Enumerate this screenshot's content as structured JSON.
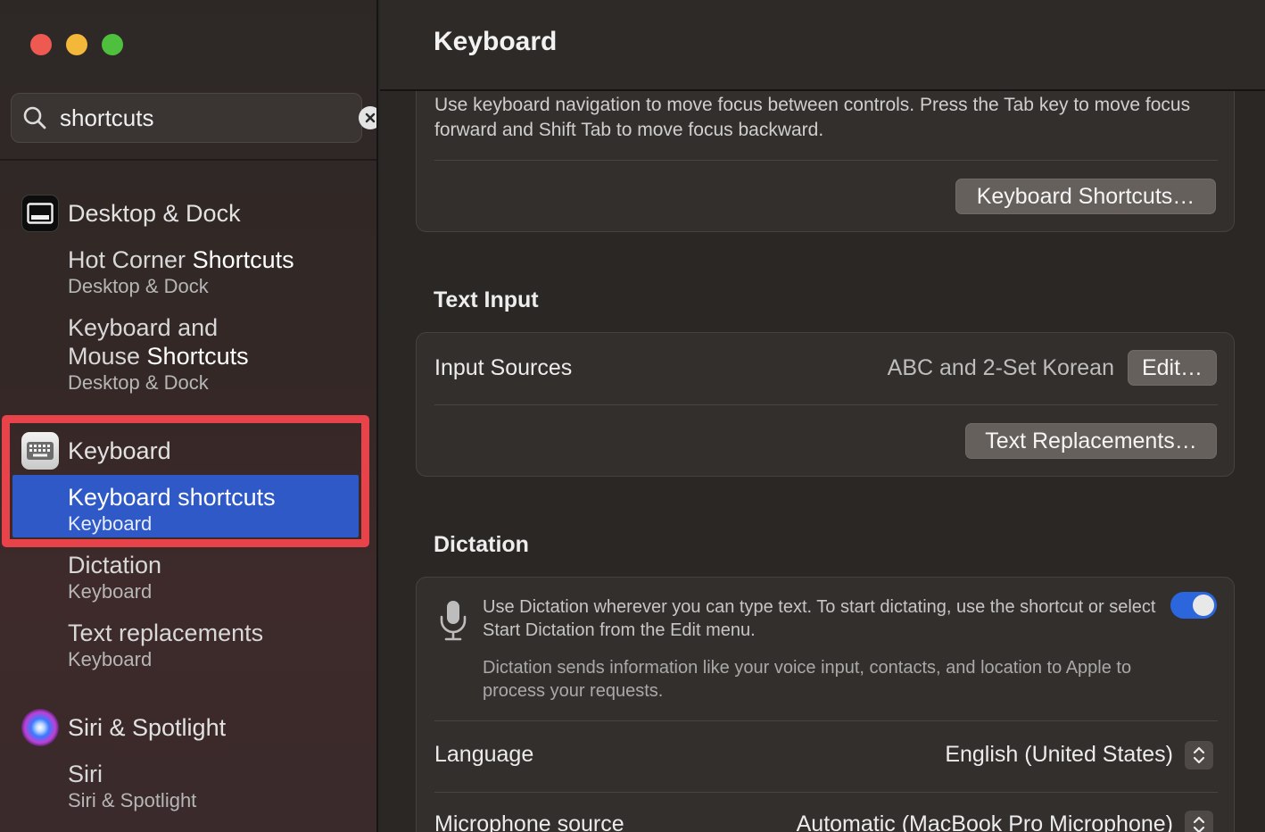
{
  "search": {
    "value": "shortcuts"
  },
  "sidebar": {
    "groups": [
      {
        "label": "Desktop & Dock",
        "results": [
          {
            "title_pre": "Hot Corner ",
            "title_match": "Shortcuts",
            "subtitle": "Desktop & Dock"
          },
          {
            "title_pre": "Keyboard and\nMouse ",
            "title_match": "Shortcuts",
            "subtitle": "Desktop & Dock"
          }
        ]
      },
      {
        "label": "Keyboard",
        "results": [
          {
            "title_pre": "Keyboard ",
            "title_match": "shortcuts",
            "subtitle": "Keyboard",
            "selected": true
          },
          {
            "title_pre": "Dictation",
            "title_match": "",
            "subtitle": "Keyboard"
          },
          {
            "title_pre": "Text replacements",
            "title_match": "",
            "subtitle": "Keyboard"
          }
        ]
      },
      {
        "label": "Siri & Spotlight",
        "results": [
          {
            "title_pre": "Siri",
            "title_match": "",
            "subtitle": "Siri & Spotlight"
          }
        ]
      }
    ]
  },
  "main": {
    "title": "Keyboard",
    "navigation": {
      "description": "Use keyboard navigation to move focus between controls. Press the Tab key to move focus forward and Shift Tab to move focus backward.",
      "shortcuts_button": "Keyboard Shortcuts…"
    },
    "text_input": {
      "section_title": "Text Input",
      "input_sources_label": "Input Sources",
      "input_sources_value": "ABC and 2-Set Korean",
      "edit_button": "Edit…",
      "replacements_button": "Text Replacements…"
    },
    "dictation": {
      "section_title": "Dictation",
      "description": "Use Dictation wherever you can type text. To start dictating, use the shortcut or select Start Dictation from the Edit menu.",
      "privacy_note": "Dictation sends information like your voice input, contacts, and location to Apple to process your requests.",
      "enabled": true,
      "language_label": "Language",
      "language_value": "English (United States)",
      "mic_label": "Microphone source",
      "mic_value": "Automatic (MacBook Pro Microphone)"
    }
  },
  "colors": {
    "selection": "#2f59c6",
    "highlight_box": "#e8424b",
    "toggle_on": "#2c66dd"
  }
}
